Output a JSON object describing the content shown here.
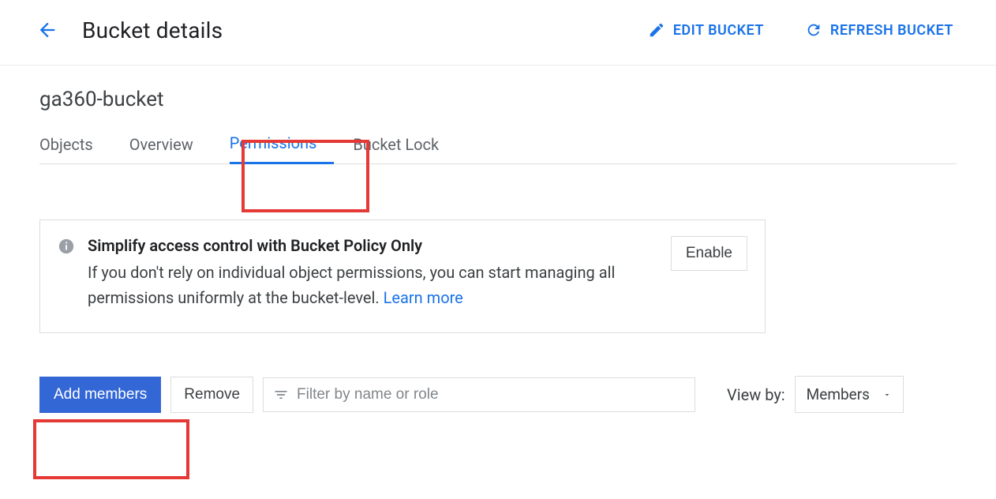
{
  "header": {
    "title": "Bucket details",
    "edit_label": "EDIT BUCKET",
    "refresh_label": "REFRESH BUCKET"
  },
  "bucket": {
    "name": "ga360-bucket"
  },
  "tabs": [
    {
      "label": "Objects",
      "active": false
    },
    {
      "label": "Overview",
      "active": false
    },
    {
      "label": "Permissions",
      "active": true
    },
    {
      "label": "Bucket Lock",
      "active": false
    }
  ],
  "info_card": {
    "title": "Simplify access control with Bucket Policy Only",
    "body": "If you don't rely on individual object permissions, you can start managing all permissions uniformly at the bucket-level. ",
    "link": "Learn more",
    "enable_label": "Enable"
  },
  "toolbar": {
    "add_label": "Add members",
    "remove_label": "Remove",
    "filter_placeholder": "Filter by name or role",
    "viewby_label": "View by:",
    "viewby_value": "Members"
  }
}
